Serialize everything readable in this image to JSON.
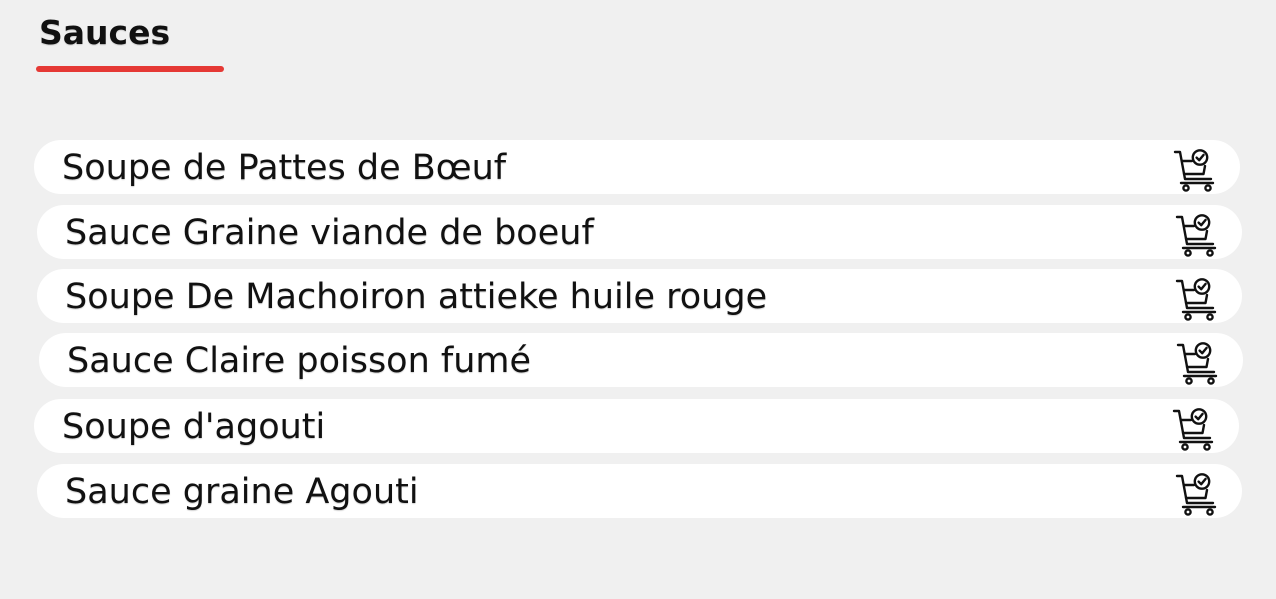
{
  "section": {
    "title": "Sauces",
    "accent_color": "#e53935"
  },
  "items": [
    {
      "name": "Soupe de Pattes de Bœuf",
      "icon": "cart-check-icon"
    },
    {
      "name": "Sauce Graine viande de boeuf",
      "icon": "cart-check-icon"
    },
    {
      "name": "Soupe De Machoiron attieke huile rouge",
      "icon": "cart-check-icon"
    },
    {
      "name": "Sauce Claire poisson fumé",
      "icon": "cart-check-icon"
    },
    {
      "name": "Soupe d'agouti",
      "icon": "cart-check-icon"
    },
    {
      "name": "Sauce graine Agouti",
      "icon": "cart-check-icon"
    }
  ]
}
